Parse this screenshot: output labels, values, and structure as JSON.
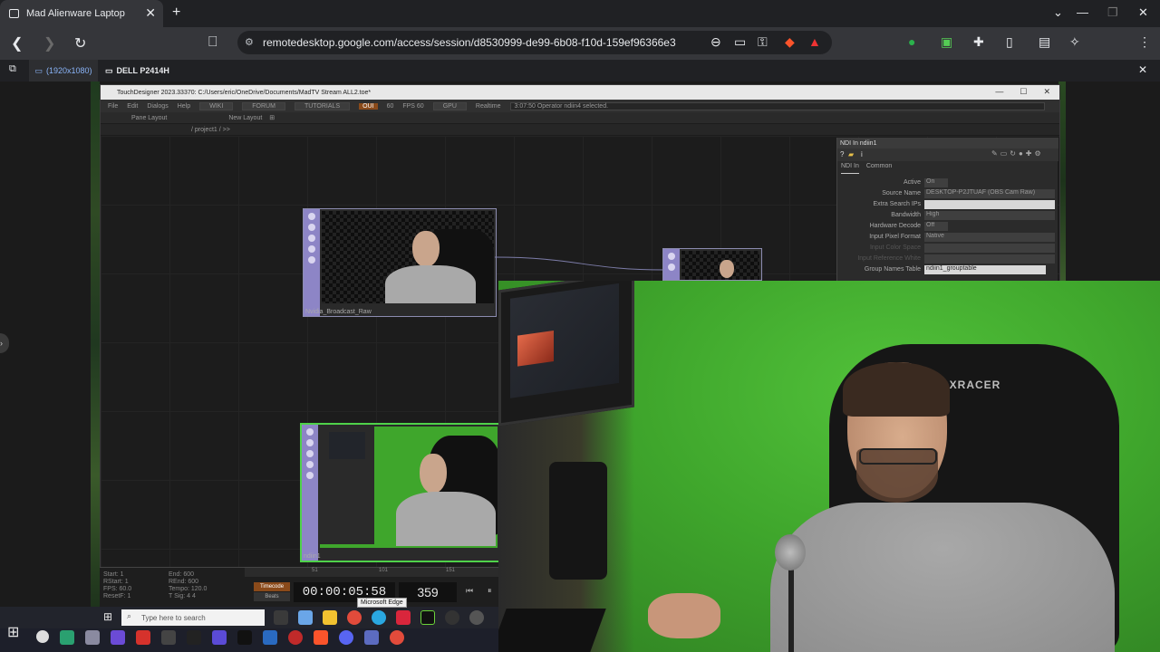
{
  "browser": {
    "tab_title": "Mad Alienware Laptop",
    "tab_close": "✕",
    "new_tab": "+",
    "url": "remotedesktop.google.com/access/session/d8530999-de99-6b08-f10d-159ef96366e3",
    "win_min": "—",
    "win_max": "❐",
    "win_close": "✕"
  },
  "remote_bar": {
    "tab1_label": "(1920x1080)",
    "tab2_label": "DELL P2414H"
  },
  "td": {
    "title": "TouchDesigner 2023.33370: C:/Users/eric/OneDrive/Documents/MadTV Stream ALL2.toe*",
    "menu": [
      "File",
      "Edit",
      "Dialogs",
      "Help"
    ],
    "wiki": "WIKI",
    "forum": "FORUM",
    "tutorials": "TUTORIALS",
    "oui": "OUI",
    "num60": "60",
    "fps": "FPS 60",
    "gpu": "GPU",
    "realtime": "Realtime",
    "status": "3:07:50 Operator ndiin4 selected.",
    "pane_layout": "Pane Layout",
    "new_layout": "New Layout",
    "path": "/ project1 / >>"
  },
  "nodes": {
    "node1_label": "Nvidia_Broadcast_Raw",
    "node3_label": "ndiin1"
  },
  "param": {
    "header": "NDI In  ndiin1",
    "tab_ndi": "NDI In",
    "tab_common": "Common",
    "rows": [
      {
        "label": "Active",
        "value": "On"
      },
      {
        "label": "Source Name",
        "value": "DESKTOP-P2JTUAF (OBS Cam Raw)"
      },
      {
        "label": "Extra Search IPs",
        "value": ""
      },
      {
        "label": "Bandwidth",
        "value": "High"
      },
      {
        "label": "Hardware Decode",
        "value": "Off"
      },
      {
        "label": "Input Pixel Format",
        "value": "Native"
      },
      {
        "label": "Input Color Space",
        "value": ""
      },
      {
        "label": "Input Reference White",
        "value": ""
      },
      {
        "label": "Group Names Table",
        "value": "ndiin1_grouptable"
      }
    ]
  },
  "timeline": {
    "stats_left": [
      "Start:  1",
      "RStart:  1",
      "FPS:  60.0",
      "ResetF:  1"
    ],
    "stats_right": [
      "End:  600",
      "REnd:  600",
      "Tempo:  120.0",
      "T Sig:  4  4"
    ],
    "timecode_tab": "Timecode",
    "beats_tab": "Beats",
    "timecode": "00:00:05:58",
    "frame": "359",
    "ticks": [
      "51",
      "101",
      "151"
    ]
  },
  "taskbar": {
    "search_placeholder": "Type here to search",
    "tooltip": "Microsoft Edge"
  },
  "webcam": {
    "chair_brand": "DXRACER"
  }
}
